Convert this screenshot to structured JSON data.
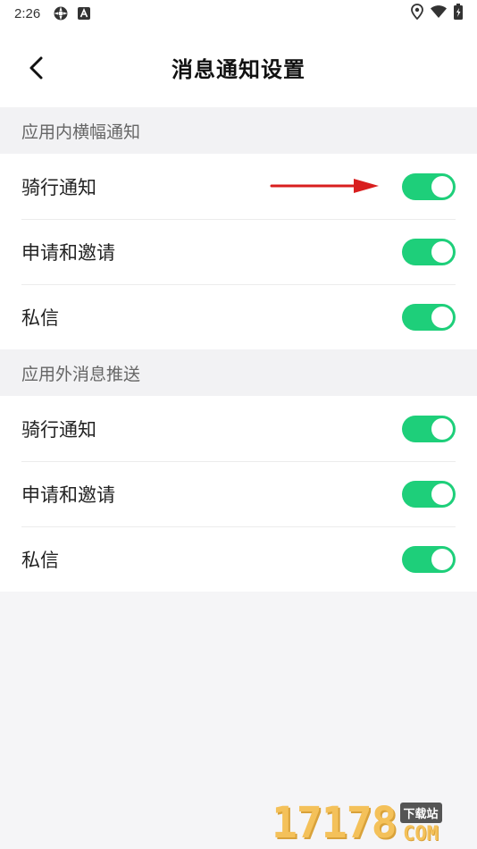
{
  "status_bar": {
    "time": "2:26",
    "left_icons": [
      "settings-icon",
      "a-badge-icon"
    ],
    "right_icons": [
      "location-icon",
      "wifi-icon",
      "battery-icon"
    ]
  },
  "header": {
    "title": "消息通知设置",
    "back_icon": "chevron-left-icon"
  },
  "sections": [
    {
      "title": "应用内横幅通知",
      "items": [
        {
          "label": "骑行通知",
          "enabled": true
        },
        {
          "label": "申请和邀请",
          "enabled": true
        },
        {
          "label": "私信",
          "enabled": true
        }
      ]
    },
    {
      "title": "应用外消息推送",
      "items": [
        {
          "label": "骑行通知",
          "enabled": true
        },
        {
          "label": "申请和邀请",
          "enabled": true
        },
        {
          "label": "私信",
          "enabled": true
        }
      ]
    }
  ],
  "colors": {
    "toggle_on": "#1ecf7a",
    "annotation_arrow": "#d81e1e"
  },
  "watermark": {
    "number": "17178",
    "tag": "下载站",
    "domain": "COM"
  }
}
